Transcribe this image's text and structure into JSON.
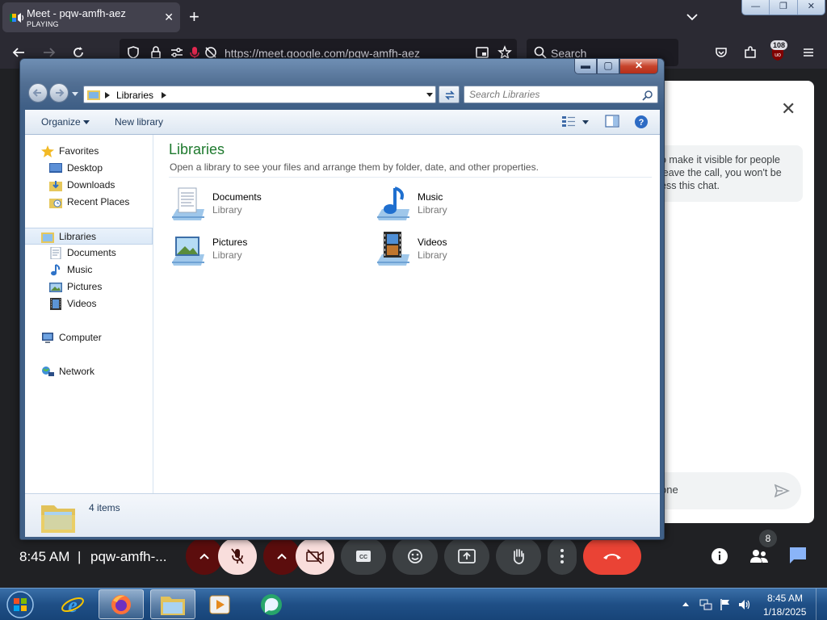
{
  "browser": {
    "tab": {
      "title": "Meet - pqw-amfh-aez",
      "status": "PLAYING",
      "close": "✕"
    },
    "new_tab": "+",
    "url": "https://meet.google.com/pqw-amfh-aez",
    "search_placeholder": "Search",
    "extension_badge": "108",
    "window_controls": {
      "minimize": "—",
      "maximize": "❐",
      "close": "✕"
    }
  },
  "meet": {
    "chat": {
      "close": "✕",
      "info_lines": [
        "o make it visible for people",
        "leave the call, you won't be",
        "ess this chat."
      ],
      "input_placeholder": "one"
    },
    "time": "8:45 AM",
    "separator": "|",
    "meeting_code": "pqw-amfh-...",
    "people_count": "8"
  },
  "explorer": {
    "caption": {
      "minimize": "▬",
      "maximize": "▢",
      "close": "✕"
    },
    "breadcrumb": "Libraries",
    "search_placeholder": "Search Libraries",
    "toolbar": {
      "organize": "Organize",
      "new_library": "New library"
    },
    "sidebar": {
      "favorites": "Favorites",
      "favorites_items": [
        "Desktop",
        "Downloads",
        "Recent Places"
      ],
      "libraries": "Libraries",
      "libraries_items": [
        "Documents",
        "Music",
        "Pictures",
        "Videos"
      ],
      "computer": "Computer",
      "network": "Network"
    },
    "content": {
      "title": "Libraries",
      "description": "Open a library to see your files and arrange them by folder, date, and other properties.",
      "items": [
        {
          "name": "Documents",
          "type": "Library",
          "icon": "documents-library-icon"
        },
        {
          "name": "Music",
          "type": "Library",
          "icon": "music-library-icon"
        },
        {
          "name": "Pictures",
          "type": "Library",
          "icon": "pictures-library-icon"
        },
        {
          "name": "Videos",
          "type": "Library",
          "icon": "videos-library-icon"
        }
      ]
    },
    "status": "4 items"
  },
  "taskbar": {
    "clock_time": "8:45 AM",
    "clock_date": "1/18/2025"
  },
  "colors": {
    "libraries_title": "#1e7a2e",
    "meet_end_call": "#ea4335",
    "taskbar": "#1f4f86"
  }
}
